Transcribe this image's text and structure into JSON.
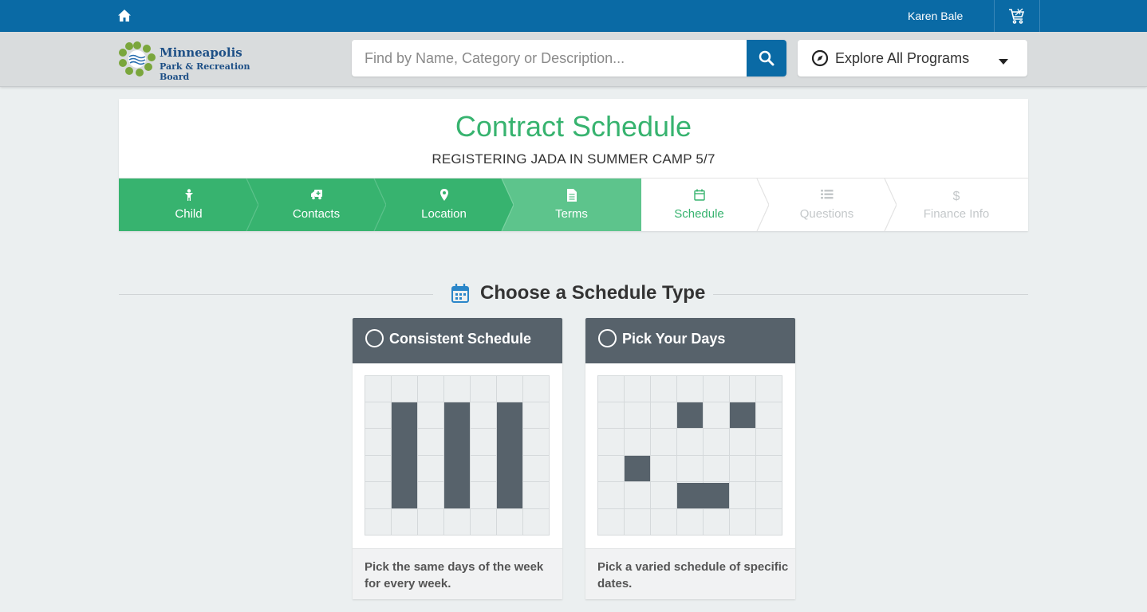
{
  "topbar": {
    "username": "Karen Bale"
  },
  "header": {
    "logo_line1": "Minneapolis",
    "logo_line2": "Park & Recreation Board",
    "search_placeholder": "Find by Name, Category or Description...",
    "explore_label": "Explore All Programs"
  },
  "card": {
    "title": "Contract Schedule",
    "subtitle": "REGISTERING JADA IN SUMMER CAMP 5/7"
  },
  "steps": [
    {
      "label": "Child",
      "icon": "child-icon",
      "state": "done"
    },
    {
      "label": "Contacts",
      "icon": "ambulance-icon",
      "state": "done"
    },
    {
      "label": "Location",
      "icon": "map-marker-icon",
      "state": "done"
    },
    {
      "label": "Terms",
      "icon": "document-icon",
      "state": "current"
    },
    {
      "label": "Schedule",
      "icon": "calendar-icon",
      "state": "active"
    },
    {
      "label": "Questions",
      "icon": "list-icon",
      "state": "todo"
    },
    {
      "label": "Finance Info",
      "icon": "dollar-icon",
      "state": "todo"
    }
  ],
  "section": {
    "title": "Choose a Schedule Type"
  },
  "options": [
    {
      "title": "Consistent Schedule",
      "description": "Pick the same days of the week for every week."
    },
    {
      "title": "Pick Your Days",
      "description": "Pick a varied schedule of specific dates."
    }
  ],
  "colors": {
    "topbar": "#0a6aa5",
    "accent_green": "#37b36f",
    "current_green": "#5dc48c",
    "card_header": "#57626b"
  }
}
